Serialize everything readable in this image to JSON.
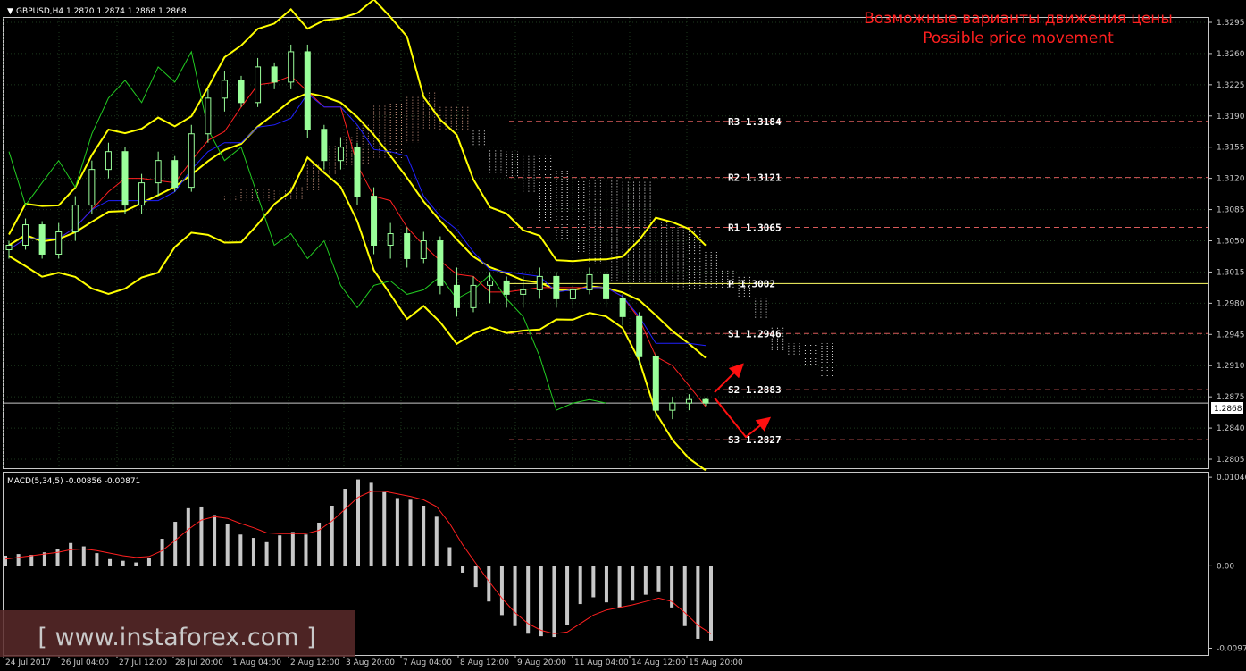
{
  "header": {
    "symbol_line": "GBPUSD,H4  1.2870 1.2874 1.2868 1.2868",
    "title_ru": "Возможные варианты движения цены",
    "title_en": "Possible price movement",
    "macd_label": "MACD(5,34,5) -0.00856 -0.00871",
    "watermark": "[ www.instaforex.com ]"
  },
  "colors": {
    "background": "#000000",
    "grid": "#1e3a1e",
    "axis": "#c8c8c8",
    "bb": "#ffff00",
    "tenkan": "#ff2020",
    "kijun": "#2020ff",
    "chikou": "#22cc22",
    "pivot_dash": "#d85a5a",
    "pivot_solid": "#ffff66",
    "title": "#ff2020",
    "macd_hist": "#c8c8c8",
    "macd_signal": "#ff2020",
    "candle": "#9aff9a",
    "arrow": "#ff1010",
    "watermark_bg": "#5a2a2a"
  },
  "chart_data": [
    {
      "type": "candlestick",
      "title": "GBPUSD,H4",
      "y_ticks": [
        "1.3295",
        "1.3260",
        "1.3225",
        "1.3190",
        "1.3155",
        "1.3120",
        "1.3085",
        "1.3050",
        "1.3015",
        "1.2980",
        "1.2945",
        "1.2910",
        "1.2875",
        "1.2840",
        "1.2805"
      ],
      "ylim": [
        1.2795,
        1.33
      ],
      "x_ticks": [
        "24 Jul 2017",
        "26 Jul 04:00",
        "27 Jul 12:00",
        "28 Jul 20:00",
        "1 Aug 04:00",
        "2 Aug 12:00",
        "3 Aug 20:00",
        "7 Aug 04:00",
        "8 Aug 12:00",
        "9 Aug 20:00",
        "11 Aug 04:00",
        "14 Aug 12:00",
        "15 Aug 20:00"
      ],
      "current_price": "1.2868",
      "pivot_levels": [
        {
          "name": "R3",
          "value": 1.3184,
          "label": "R3  1.3184"
        },
        {
          "name": "R2",
          "value": 1.3121,
          "label": "R2  1.3121"
        },
        {
          "name": "R1",
          "value": 1.3065,
          "label": "R1  1.3065"
        },
        {
          "name": "P",
          "value": 1.3002,
          "label": "P  1.3002"
        },
        {
          "name": "S1",
          "value": 1.2946,
          "label": "S1  1.2946"
        },
        {
          "name": "S2",
          "value": 1.2883,
          "label": "S2  1.2883"
        },
        {
          "name": "S3",
          "value": 1.2827,
          "label": "S3  1.2827"
        }
      ],
      "series": [
        {
          "values": [
            [
              1.304,
              1.305,
              1.303,
              1.3045
            ],
            [
              1.3045,
              1.3075,
              1.304,
              1.3068
            ],
            [
              1.3068,
              1.3072,
              1.303,
              1.3035
            ],
            [
              1.3035,
              1.307,
              1.303,
              1.306
            ],
            [
              1.306,
              1.31,
              1.305,
              1.309
            ],
            [
              1.309,
              1.314,
              1.308,
              1.313
            ],
            [
              1.313,
              1.316,
              1.312,
              1.315
            ],
            [
              1.315,
              1.3155,
              1.308,
              1.309
            ],
            [
              1.309,
              1.3125,
              1.308,
              1.3115
            ],
            [
              1.3115,
              1.315,
              1.31,
              1.314
            ],
            [
              1.314,
              1.3145,
              1.3105,
              1.311
            ],
            [
              1.311,
              1.318,
              1.3105,
              1.317
            ],
            [
              1.317,
              1.322,
              1.316,
              1.321
            ],
            [
              1.321,
              1.324,
              1.3195,
              1.323
            ],
            [
              1.323,
              1.3235,
              1.32,
              1.3205
            ],
            [
              1.3205,
              1.3255,
              1.32,
              1.3245
            ],
            [
              1.3245,
              1.325,
              1.322,
              1.3228
            ],
            [
              1.3228,
              1.327,
              1.322,
              1.3262
            ],
            [
              1.3262,
              1.327,
              1.3165,
              1.3175
            ],
            [
              1.3175,
              1.318,
              1.313,
              1.314
            ],
            [
              1.314,
              1.3165,
              1.313,
              1.3155
            ],
            [
              1.3155,
              1.316,
              1.309,
              1.31
            ],
            [
              1.31,
              1.311,
              1.3035,
              1.3045
            ],
            [
              1.3045,
              1.307,
              1.303,
              1.3058
            ],
            [
              1.3058,
              1.3065,
              1.302,
              1.303
            ],
            [
              1.303,
              1.306,
              1.3025,
              1.305
            ],
            [
              1.305,
              1.3055,
              1.299,
              1.3
            ],
            [
              1.3,
              1.302,
              1.2965,
              1.2975
            ],
            [
              1.2975,
              1.301,
              1.297,
              1.3
            ],
            [
              1.3,
              1.3015,
              1.298,
              1.3005
            ],
            [
              1.3005,
              1.301,
              1.2975,
              1.299
            ],
            [
              1.299,
              1.301,
              1.2975,
              1.2995
            ],
            [
              1.2995,
              1.302,
              1.2985,
              1.301
            ],
            [
              1.301,
              1.3015,
              1.2975,
              1.2985
            ],
            [
              1.2985,
              1.3,
              1.2975,
              1.2995
            ],
            [
              1.2995,
              1.302,
              1.299,
              1.3012
            ],
            [
              1.3012,
              1.3015,
              1.2975,
              1.2985
            ],
            [
              1.2985,
              1.299,
              1.2955,
              1.2965
            ],
            [
              1.2965,
              1.297,
              1.291,
              1.292
            ],
            [
              1.292,
              1.2925,
              1.285,
              1.286
            ],
            [
              1.286,
              1.2875,
              1.285,
              1.2868
            ],
            [
              1.2868,
              1.2878,
              1.286,
              1.2872
            ],
            [
              1.2872,
              1.2874,
              1.2865,
              1.2868
            ]
          ]
        }
      ]
    },
    {
      "type": "bar",
      "title": "MACD(5,34,5)",
      "y_ticks": [
        "0.01046",
        "0.00",
        "-0.00971"
      ],
      "ylim": [
        -0.0105,
        0.011
      ],
      "series": [
        {
          "name": "histogram",
          "values": [
            0.0012,
            0.0014,
            0.0013,
            0.0016,
            0.002,
            0.0027,
            0.0023,
            0.0015,
            0.0008,
            0.0006,
            0.0004,
            0.0009,
            0.0032,
            0.0052,
            0.0068,
            0.007,
            0.006,
            0.0049,
            0.0037,
            0.0033,
            0.0028,
            0.0036,
            0.004,
            0.0037,
            0.0051,
            0.0071,
            0.0091,
            0.0102,
            0.0098,
            0.0087,
            0.008,
            0.0078,
            0.0071,
            0.0058,
            0.0022,
            -0.0008,
            -0.0025,
            -0.0042,
            -0.0058,
            -0.0071,
            -0.008,
            -0.0083,
            -0.0084,
            -0.007,
            -0.0045,
            -0.0037,
            -0.0043,
            -0.0049,
            -0.0041,
            -0.0034,
            -0.0031,
            -0.0049,
            -0.0071,
            -0.0086,
            -0.0088
          ]
        },
        {
          "name": "signal",
          "values": [
            0.0008,
            0.001,
            0.0012,
            0.0014,
            0.0016,
            0.0019,
            0.002,
            0.0018,
            0.0015,
            0.0012,
            0.001,
            0.0011,
            0.0018,
            0.003,
            0.0043,
            0.0054,
            0.0058,
            0.0056,
            0.005,
            0.0045,
            0.0039,
            0.0038,
            0.0038,
            0.0038,
            0.0042,
            0.0053,
            0.0067,
            0.0081,
            0.0088,
            0.0088,
            0.0085,
            0.0082,
            0.0078,
            0.007,
            0.005,
            0.0025,
            0.0003,
            -0.0018,
            -0.0038,
            -0.0055,
            -0.0068,
            -0.0076,
            -0.008,
            -0.0078,
            -0.0068,
            -0.0058,
            -0.0052,
            -0.0049,
            -0.0046,
            -0.0042,
            -0.0038,
            -0.0042,
            -0.0055,
            -0.007,
            -0.008
          ]
        }
      ]
    }
  ]
}
